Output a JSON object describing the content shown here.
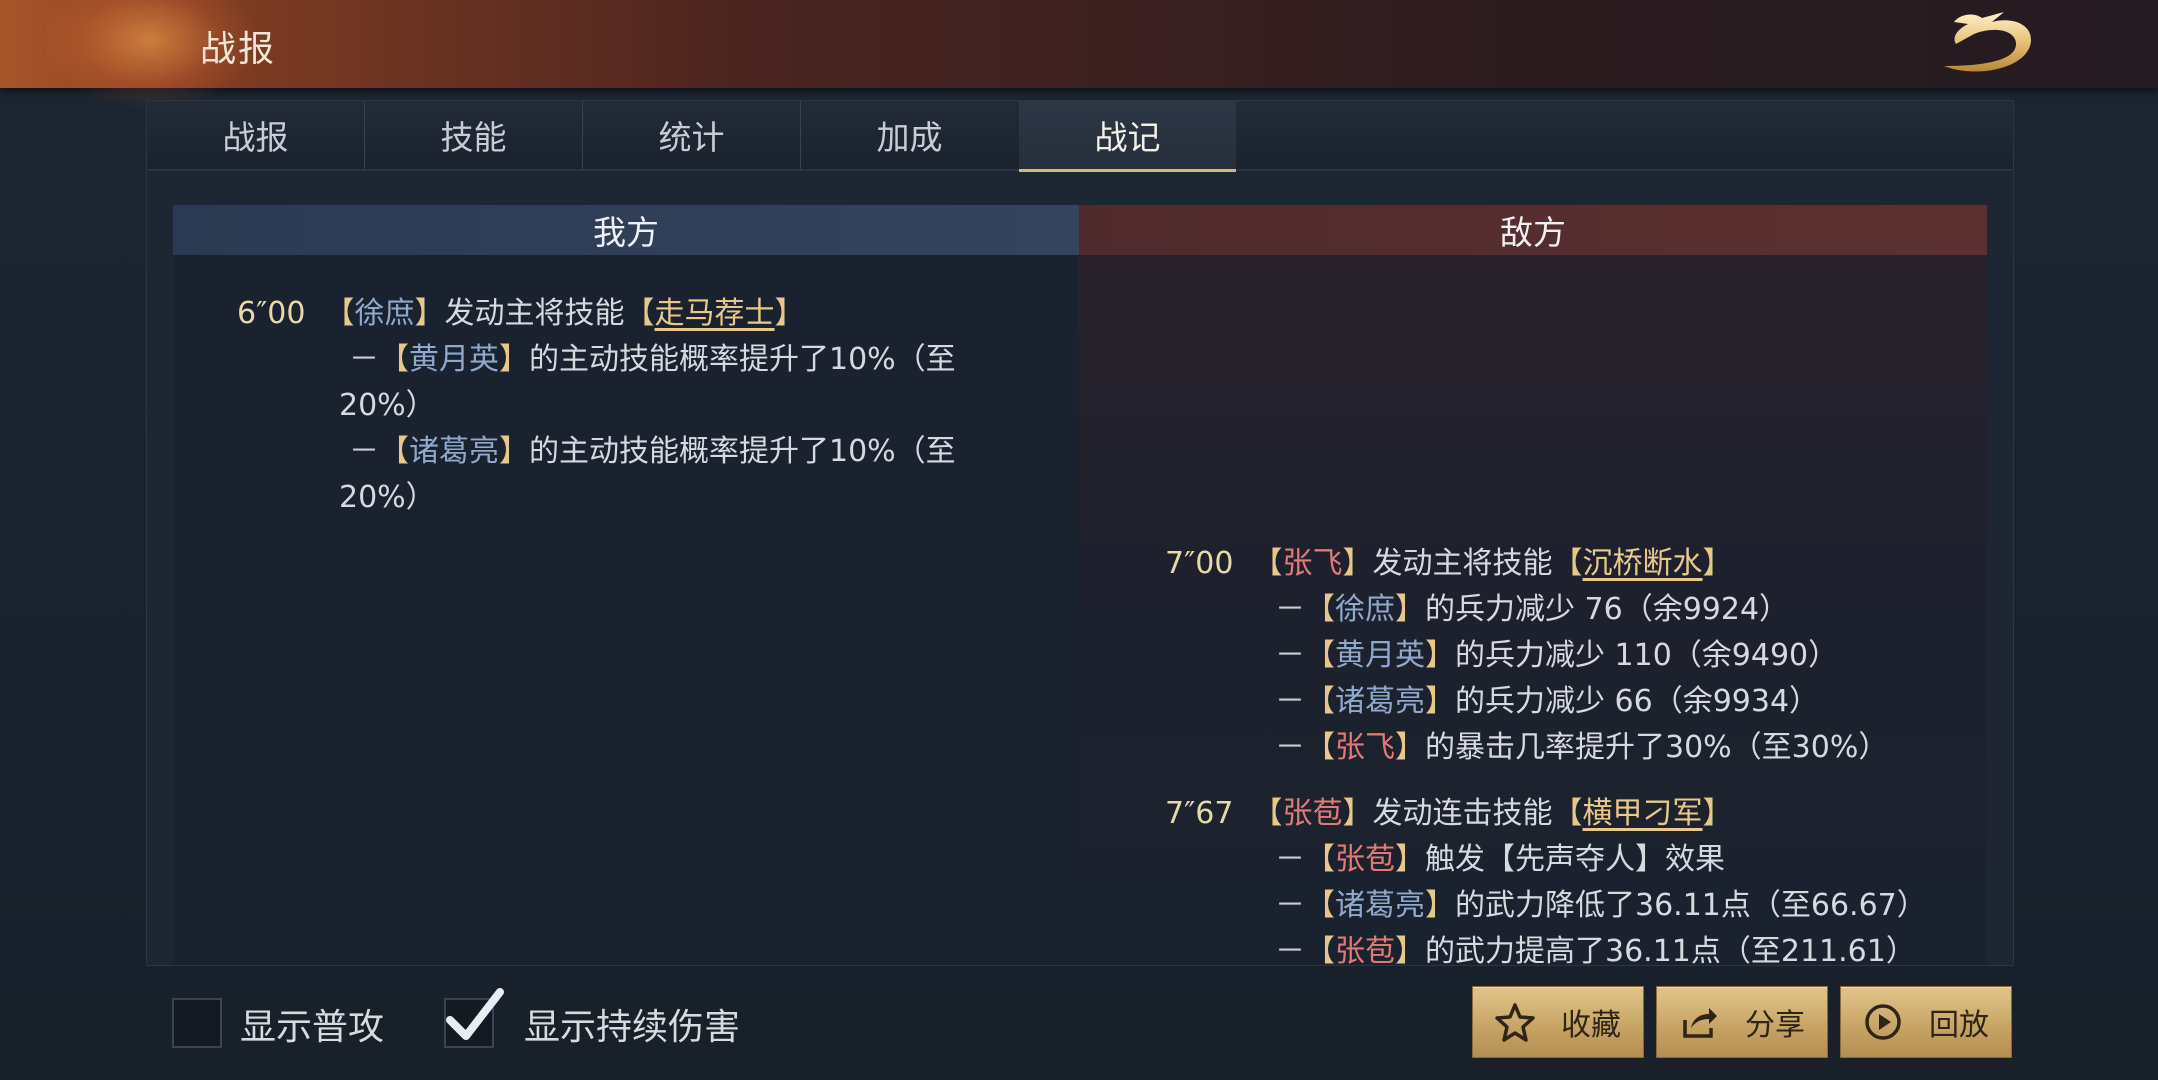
{
  "header": {
    "title": "战报"
  },
  "tabs": [
    {
      "label": "战报",
      "active": false
    },
    {
      "label": "技能",
      "active": false
    },
    {
      "label": "统计",
      "active": false
    },
    {
      "label": "加成",
      "active": false
    },
    {
      "label": "战记",
      "active": true
    }
  ],
  "columns": {
    "ours": "我方",
    "enemy": "敌方"
  },
  "log": {
    "e1": {
      "time": "6″00",
      "actor": "徐庶",
      "action": "发动主将技能",
      "skill": "走马荐士",
      "lines": [
        {
          "target": "黄月英",
          "text1": "的主动技能概率提升了10%（至",
          "text2": "20%）"
        },
        {
          "target": "诸葛亮",
          "text1": "的主动技能概率提升了10%（至",
          "text2": "20%）"
        }
      ]
    },
    "e2": {
      "time": "7″00",
      "actor": "张飞",
      "action": "发动主将技能",
      "skill": "沉桥断水",
      "lines": [
        {
          "target": "徐庶",
          "text": "的兵力减少 76（余9924）"
        },
        {
          "target": "黄月英",
          "text": "的兵力减少 110（余9490）"
        },
        {
          "target": "诸葛亮",
          "text": "的兵力减少 66（余9934）"
        },
        {
          "target": "张飞",
          "text": "的暴击几率提升了30%（至30%）"
        }
      ]
    },
    "e3": {
      "time": "7″67",
      "actor": "张苞",
      "action": "发动连击技能",
      "skill": "横甲刁军",
      "lines": [
        {
          "target": "张苞",
          "text": "触发【先声夺人】效果"
        },
        {
          "target": "诸葛亮",
          "text": "的武力降低了36.11点（至66.67）"
        },
        {
          "target": "张苞",
          "text": "的武力提高了36.11点（至211.61）"
        }
      ]
    }
  },
  "options": {
    "show_normal_attack": {
      "label": "显示普攻",
      "checked": false
    },
    "show_dot": {
      "label": "显示持续伤害",
      "checked": true
    }
  },
  "buttons": {
    "favorite": {
      "label": "收藏",
      "icon": "star-icon"
    },
    "share": {
      "label": "分享",
      "icon": "share-icon"
    },
    "replay": {
      "label": "回放",
      "icon": "play-icon"
    }
  },
  "colors": {
    "accent_gold": "#d4b87a",
    "ally_blue": "#8fa8cc",
    "enemy_red": "#e07a74",
    "skill_gold": "#e9c98a"
  }
}
